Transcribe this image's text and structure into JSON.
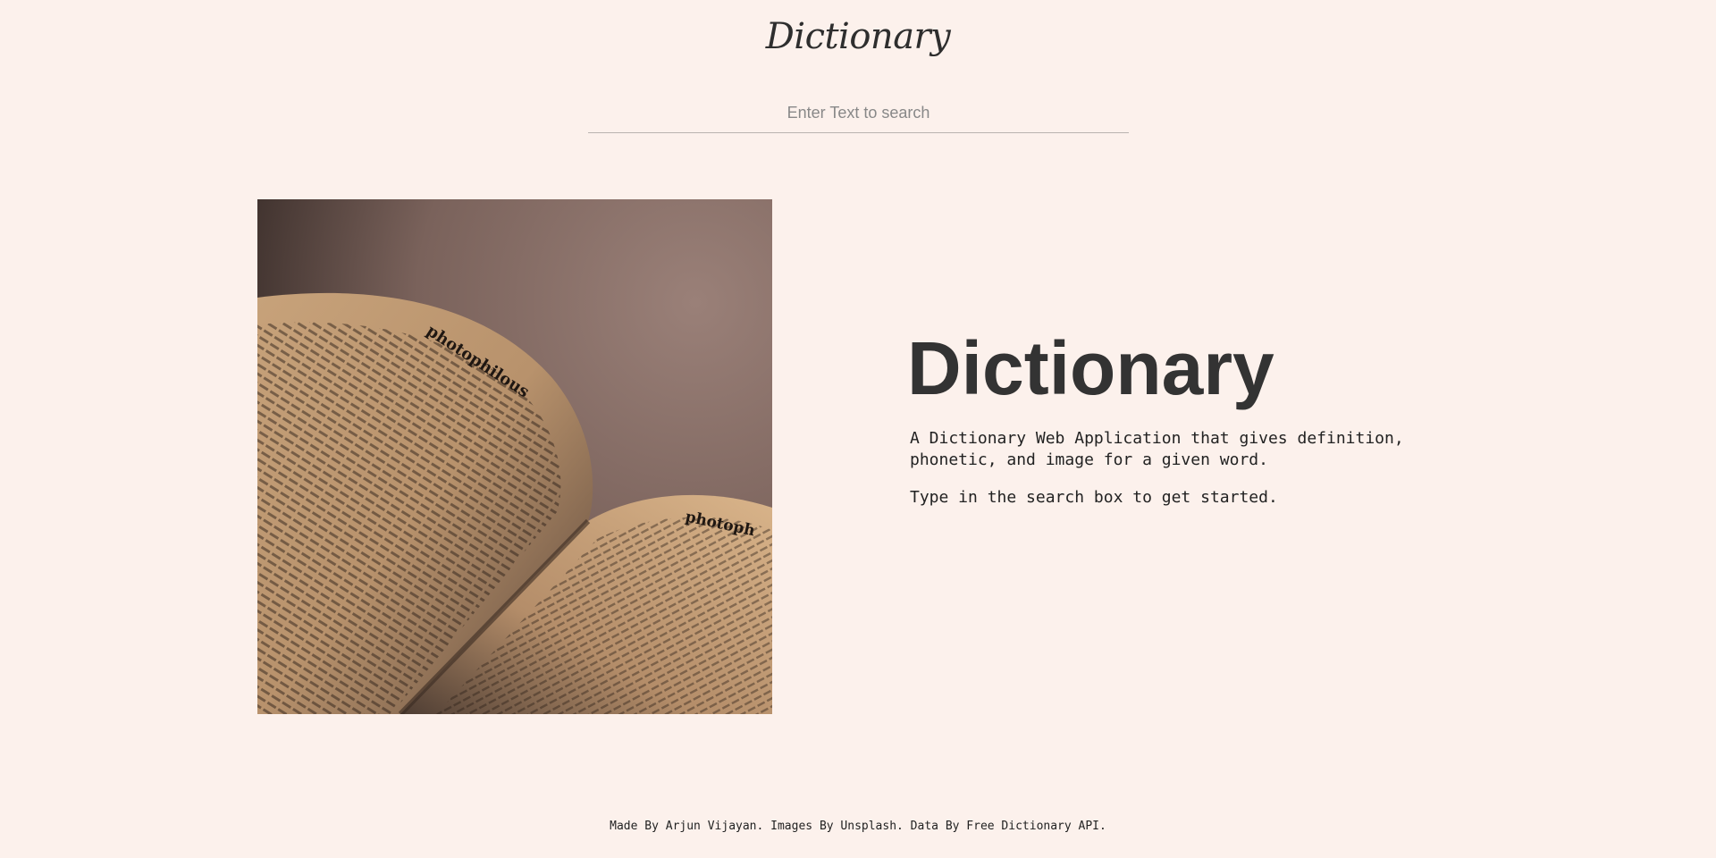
{
  "header": {
    "logo_text": "Dictionary"
  },
  "search": {
    "placeholder": "Enter Text to search",
    "value": ""
  },
  "hero": {
    "image_alt": "Open dictionary book",
    "title": "Dictionary",
    "description": "A Dictionary Web Application that gives definition, phonetic, and image for a given word.",
    "call_to_action": "Type in the search box to get started."
  },
  "footer": {
    "credits": "Made By Arjun Vijayan. Images By Unsplash. Data By Free Dictionary API."
  },
  "colors": {
    "background": "#fcf1ec",
    "text": "#333333",
    "search_underline": "#b9b3b0"
  }
}
